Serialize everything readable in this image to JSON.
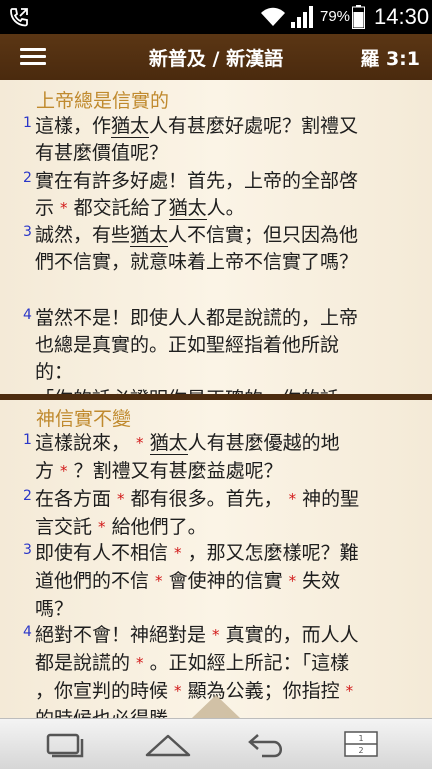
{
  "status_bar": {
    "battery": "79%",
    "time": "14:30"
  },
  "header": {
    "title": "新普及 / 新漢語",
    "reference": "羅 3:1"
  },
  "pane1": {
    "heading": "上帝總是信實的",
    "verses": [
      {
        "num": "1",
        "lines": [
          "這樣，作猶太人有甚麼好處呢？割禮又",
          "有甚麼價值呢？"
        ]
      },
      {
        "num": "2",
        "lines": [
          "實在有許多好處！首先，上帝的全部啓",
          "示 * 都交託給了猶太人。"
        ]
      },
      {
        "num": "3",
        "lines": [
          "誠然，有些猶太人不信實；但只因為他",
          "們不信實，就意味着上帝不信實了嗎？"
        ]
      },
      {
        "num": "4",
        "lines": [
          "當然不是！即使人人都是說謊的，上帝",
          "也總是真實的。正如聖經指着他所說",
          "的：",
          "「你的話必證明你是正確的，你的話"
        ]
      }
    ]
  },
  "pane2": {
    "heading": "神信實不變",
    "verses": [
      {
        "num": "1",
        "lines": [
          "這樣說來， * 猶太人有甚麼優越的地",
          "方 * ？割禮又有甚麼益處呢？"
        ]
      },
      {
        "num": "2",
        "lines": [
          "在各方面 * 都有很多。首先， * 神的聖",
          "言交託 * 給他們了。"
        ]
      },
      {
        "num": "3",
        "lines": [
          "即使有人不相信 * ，那又怎麼樣呢？難",
          "道他們的不信 * 會使神的信實 * 失效",
          "嗎？"
        ]
      },
      {
        "num": "4",
        "lines": [
          "絕對不會！神絕對是 * 真實的，而人人",
          "都是說謊的 * 。正如經上所記：「這樣",
          "，你宣判的時候 * 顯為公義；你指控 *",
          "的時候也必得勝。"
        ]
      }
    ]
  },
  "colors": {
    "header_bg": "#4a2a0e",
    "heading": "#c08a2e",
    "verse_num": "#2a36c8",
    "footnote_star": "#d21a1a"
  },
  "icons": [
    "phone-icon",
    "wifi-icon",
    "signal-icon",
    "battery-icon",
    "menu-icon",
    "up-arrow-icon",
    "back-icon",
    "home-icon",
    "recent-apps-icon",
    "split-screen-icon"
  ]
}
